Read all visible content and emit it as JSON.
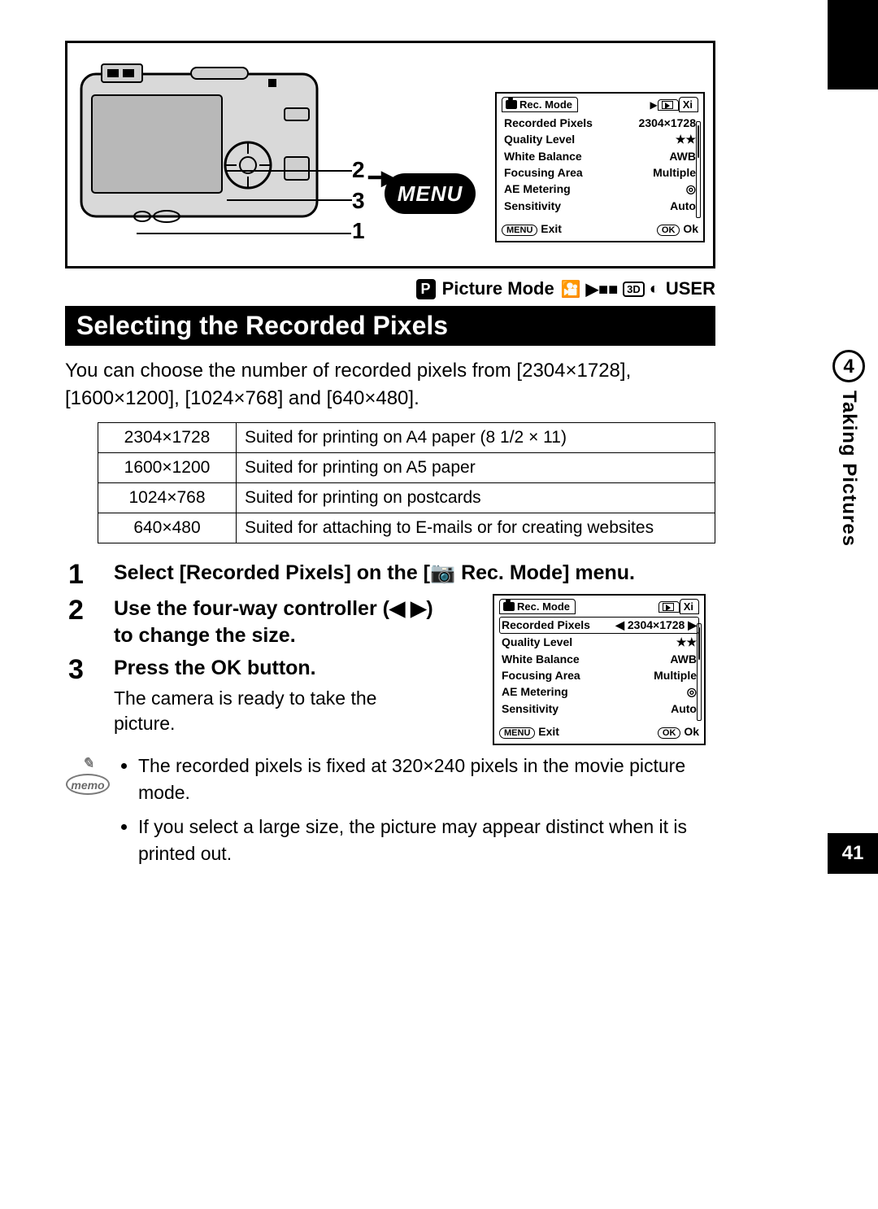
{
  "page_number": "41",
  "side_section_number": "4",
  "side_section_title": "Taking Pictures",
  "diagram": {
    "callout_1": "1",
    "callout_2": "2",
    "callout_3": "3",
    "menu_label": "MENU"
  },
  "top_mini_screen": {
    "tab_active": "Rec. Mode",
    "rows": [
      {
        "label": "Recorded Pixels",
        "value": "2304×1728"
      },
      {
        "label": "Quality Level",
        "value": "★★"
      },
      {
        "label": "White Balance",
        "value": "AWB"
      },
      {
        "label": "Focusing Area",
        "value": "Multiple"
      },
      {
        "label": "AE Metering",
        "value": "◎"
      },
      {
        "label": "Sensitivity",
        "value": "Auto"
      }
    ],
    "footer_left_pill": "MENU",
    "footer_left": "Exit",
    "footer_right_pill": "OK",
    "footer_right": "Ok"
  },
  "mode_row": {
    "label": "Picture Mode",
    "user": "USER"
  },
  "heading": "Selecting the Recorded Pixels",
  "intro": "You can choose the number of recorded pixels from [2304×1728], [1600×1200], [1024×768] and [640×480].",
  "table": [
    {
      "size": "2304×1728",
      "desc": "Suited for printing on A4 paper (8 1/2 × 11)"
    },
    {
      "size": "1600×1200",
      "desc": "Suited for printing on A5 paper"
    },
    {
      "size": "1024×768",
      "desc": "Suited for printing on postcards"
    },
    {
      "size": "640×480",
      "desc": "Suited for attaching to E-mails or for creating websites"
    }
  ],
  "steps": {
    "s1_num": "1",
    "s1_txt": "Select [Recorded Pixels] on the [📷 Rec. Mode] menu.",
    "s2_num": "2",
    "s2_txt": "Use the four-way controller (◀ ▶) to change the size.",
    "s3_num": "3",
    "s3_txt": "Press the OK button.",
    "s3_sub": "The camera is ready to take the picture."
  },
  "bottom_mini_screen": {
    "tab_active": "Rec. Mode",
    "rows": [
      {
        "label": "Recorded Pixels",
        "value": "2304×1728"
      },
      {
        "label": "Quality Level",
        "value": "★★"
      },
      {
        "label": "White Balance",
        "value": "AWB"
      },
      {
        "label": "Focusing Area",
        "value": "Multiple"
      },
      {
        "label": "AE Metering",
        "value": "◎"
      },
      {
        "label": "Sensitivity",
        "value": "Auto"
      }
    ],
    "footer_left_pill": "MENU",
    "footer_left": "Exit",
    "footer_right_pill": "OK",
    "footer_right": "Ok"
  },
  "memo": {
    "label": "memo",
    "bullets": [
      "The recorded pixels is fixed at 320×240 pixels in the movie picture mode.",
      "If you select a large size, the picture may appear distinct when it is printed out."
    ]
  }
}
